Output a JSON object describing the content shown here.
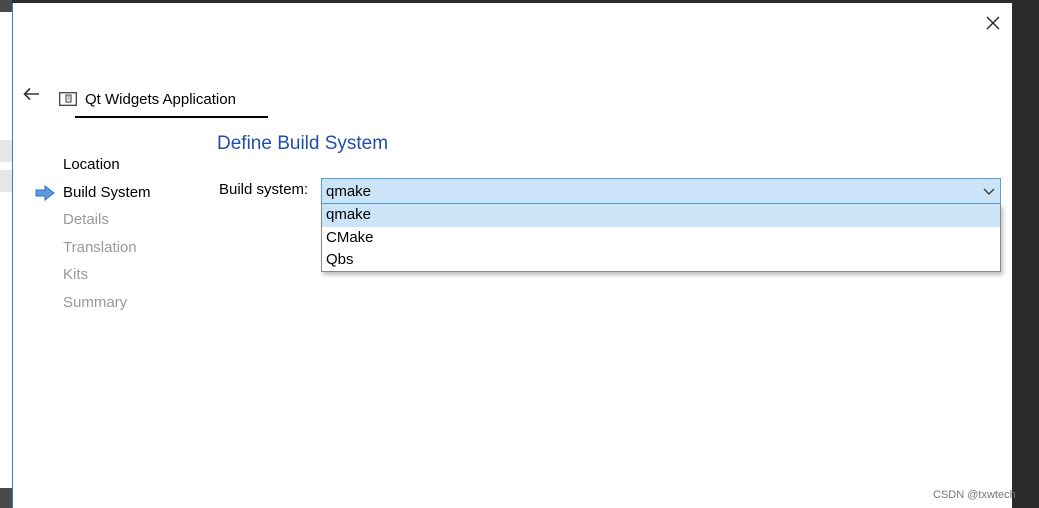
{
  "dialog": {
    "close_icon": "close-icon",
    "back_icon": "back-arrow-icon"
  },
  "header": {
    "icon": "qt-project-icon",
    "title": "Qt Widgets Application"
  },
  "steps": [
    {
      "label": "Location",
      "state": "done"
    },
    {
      "label": "Build System",
      "state": "current"
    },
    {
      "label": "Details",
      "state": "pending"
    },
    {
      "label": "Translation",
      "state": "pending"
    },
    {
      "label": "Kits",
      "state": "pending"
    },
    {
      "label": "Summary",
      "state": "pending"
    }
  ],
  "page": {
    "title": "Define Build System",
    "field_label": "Build system:"
  },
  "combo": {
    "value": "qmake",
    "chevron_icon": "chevron-down-icon",
    "options": [
      "qmake",
      "CMake",
      "Qbs"
    ],
    "selected_index": 0
  },
  "colors": {
    "accent": "#1f4fa8",
    "selection": "#cce4f7",
    "combo_border": "#5a9bd8",
    "step_arrow": "#3b82d6"
  },
  "watermark": "CSDN @txwtech"
}
